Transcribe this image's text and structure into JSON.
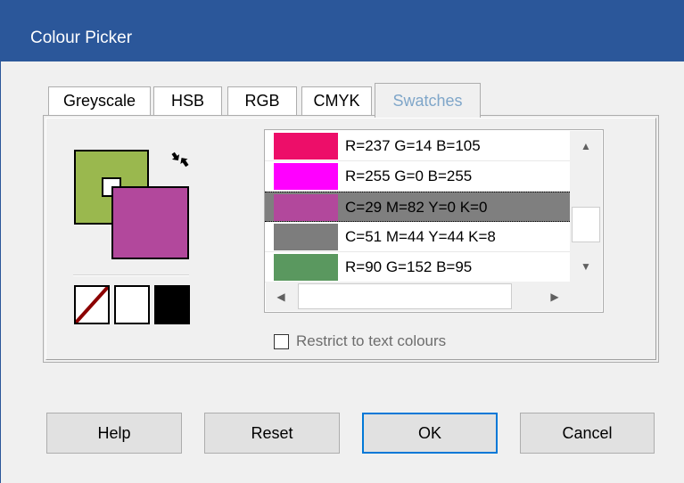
{
  "window": {
    "title": "Colour Picker"
  },
  "tabs": [
    {
      "label": "Greyscale"
    },
    {
      "label": "HSB"
    },
    {
      "label": "RGB"
    },
    {
      "label": "CMYK"
    },
    {
      "label": "Swatches",
      "active": true
    }
  ],
  "colors": {
    "titlebar": "#2b579a",
    "foreground": "#9ab84e",
    "background": "#b2489c",
    "active_tab_text": "#7fa6c9"
  },
  "swatch_list": [
    {
      "color": "#ed0e69",
      "label": "R=237 G=14 B=105"
    },
    {
      "color": "#ff00ff",
      "label": "R=255 G=0 B=255"
    },
    {
      "color": "#b2489c",
      "label": "C=29 M=82 Y=0 K=0",
      "selected": true
    },
    {
      "color": "#7d7d7d",
      "label": "C=51 M=44 Y=44 K=8"
    },
    {
      "color": "#5a985f",
      "label": "R=90 G=152 B=95"
    }
  ],
  "icons": {
    "swap": "swap-colors-icon",
    "up": "▲",
    "down": "▼",
    "left": "◀",
    "right": "▶"
  },
  "restrict_checkbox": {
    "label": "Restrict to text colours",
    "checked": false
  },
  "buttons": {
    "help": "Help",
    "reset": "Reset",
    "ok": "OK",
    "cancel": "Cancel"
  }
}
